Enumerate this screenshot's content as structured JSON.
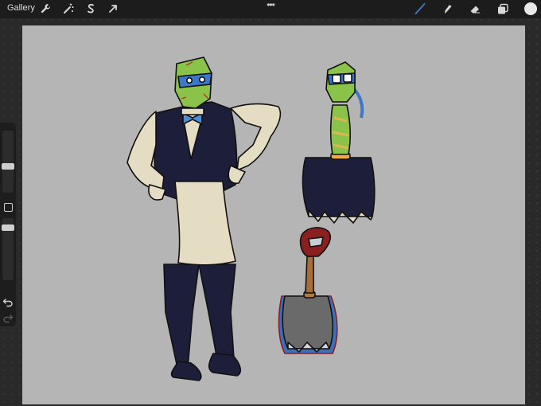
{
  "app": {
    "gallery_label": "Gallery"
  },
  "toolbar": {
    "left_tools": [
      "wrench-icon",
      "magic-wand-icon",
      "selection-icon",
      "transform-arrow-icon"
    ],
    "right_tools": [
      "brush-icon",
      "smudge-icon",
      "eraser-icon",
      "layers-icon"
    ],
    "active_tool": "brush-icon",
    "active_color": "#3a7bd5",
    "current_color": "#e8e8e8",
    "more_label": "•••"
  },
  "sidebar": {
    "brush_size_level": 0.25,
    "opacity_level": 0.2
  },
  "canvas": {
    "background": "#b5b5b5"
  },
  "artwork": {
    "characters": [
      "turtle-waiter-figure",
      "turtle-broom-figure",
      "broom-figure"
    ]
  }
}
